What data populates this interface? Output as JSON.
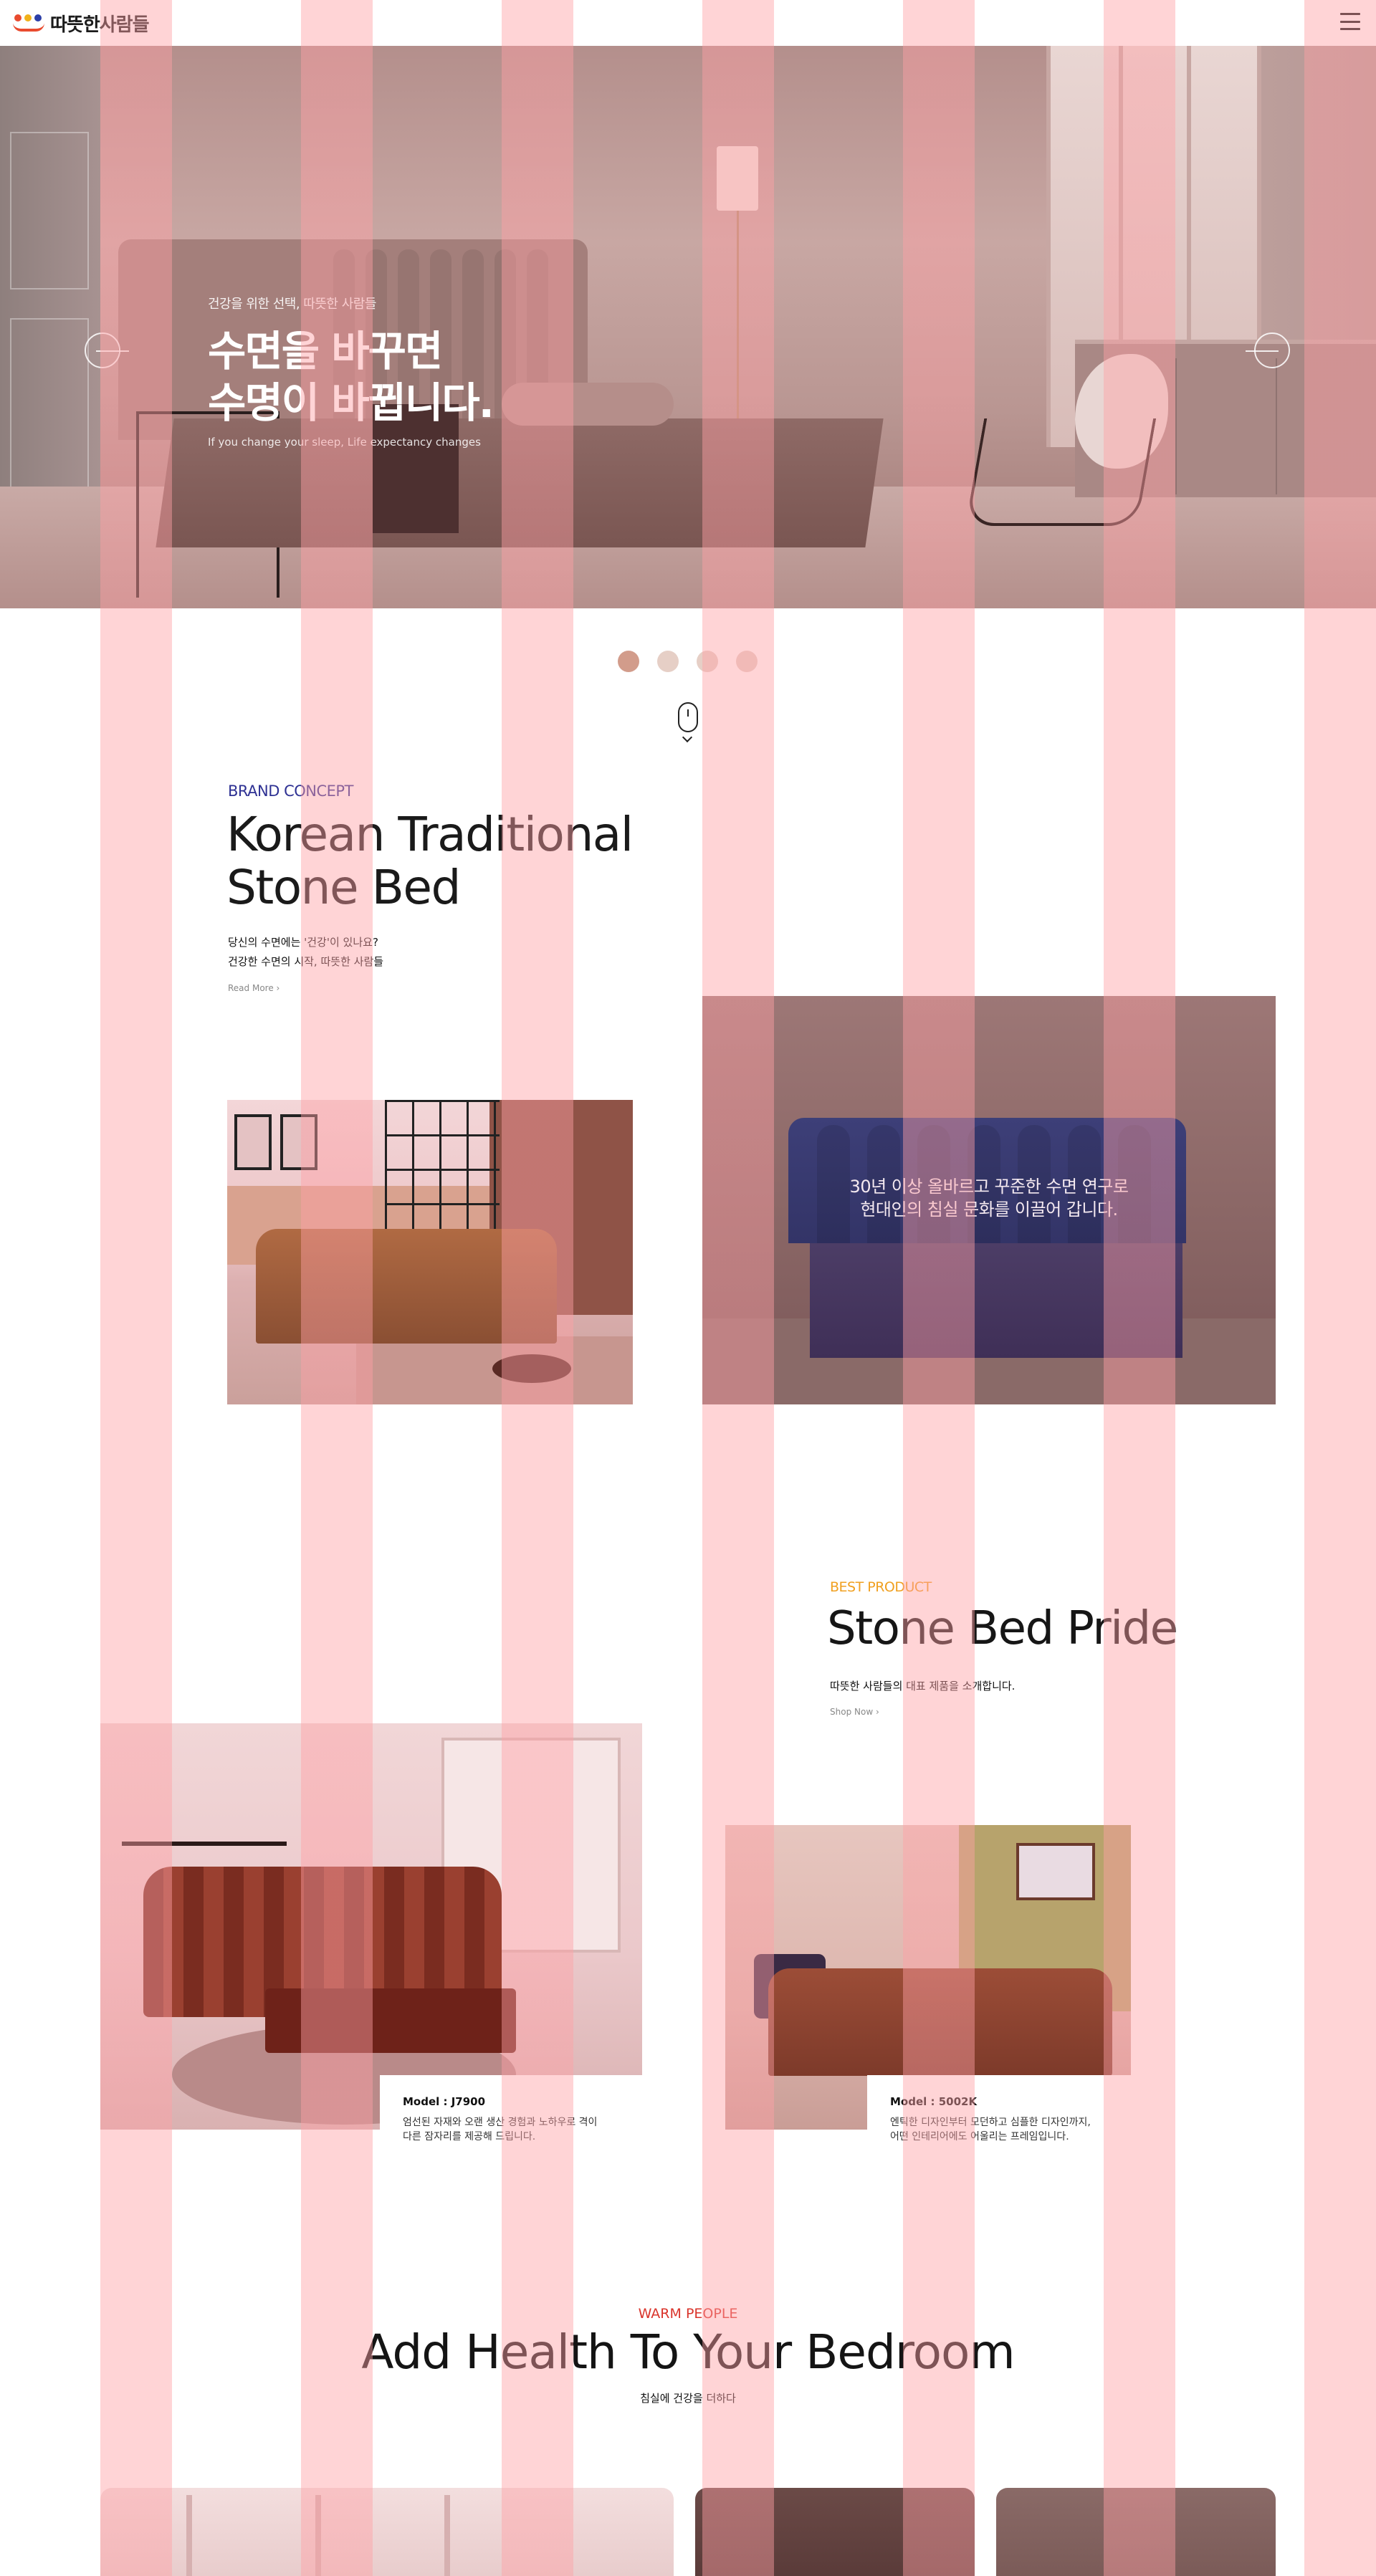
{
  "header": {
    "logo_text": "따뜻한사람들",
    "menu_icon": "hamburger-menu-icon"
  },
  "hero": {
    "subtitle": "건강을 위한 선택, 따뜻한 사람들",
    "title_line1": "수면을 바꾸면",
    "title_line2": "수명이 바뀝니다.",
    "english": "If you change your sleep, Life expectancy changes",
    "prev_icon": "arrow-left-circle-icon",
    "next_icon": "arrow-right-circle-icon"
  },
  "slider": {
    "dot_count": 4,
    "active_index": 0
  },
  "scroll": {
    "icon": "mouse-scroll-icon"
  },
  "brand_concept": {
    "eyebrow": "BRAND CONCEPT",
    "title_line1": "Korean Traditional",
    "title_line2": "Stone Bed",
    "desc_line1": "당신의 수면에는 '건강'이 있나요?",
    "desc_line2": "건강한 수면의 시작, 따뜻한 사람들",
    "more": "Read More ›",
    "image_caption_line1": "30년 이상 올바르고 꾸준한 수면 연구로",
    "image_caption_line2": "현대인의 침실 문화를 이끌어 갑니다."
  },
  "best_product": {
    "eyebrow": "BEST PRODUCT",
    "title": "Stone Bed Pride",
    "desc": "따뜻한 사람들의 대표 제품을 소개합니다.",
    "more": "Shop Now ›",
    "items": [
      {
        "model": "Model : J7900",
        "desc_line1": "엄선된 자재와 오랜 생산 경험과 노하우로 격이",
        "desc_line2": "다른 잠자리를 제공해 드립니다."
      },
      {
        "model": "Model : 5002K",
        "desc_line1": "엔틱한  디자인부터 모던하고 심플한 디자인까지,",
        "desc_line2": "어떤 인테리어에도 어울리는 프레임입니다."
      }
    ]
  },
  "warm_people": {
    "eyebrow": "WARM PEOPLE",
    "title": "Add Health To Your Bedroom",
    "subtitle": "침실에 건강을 더하다"
  },
  "colors": {
    "concept_blue": "#2e3193",
    "best_orange": "#f0a020",
    "warm_red": "#d9342b",
    "dot_active": "#d29c8b",
    "dot_inactive": "#e6cfc6",
    "stripe_overlay": "#ffa0a5"
  }
}
